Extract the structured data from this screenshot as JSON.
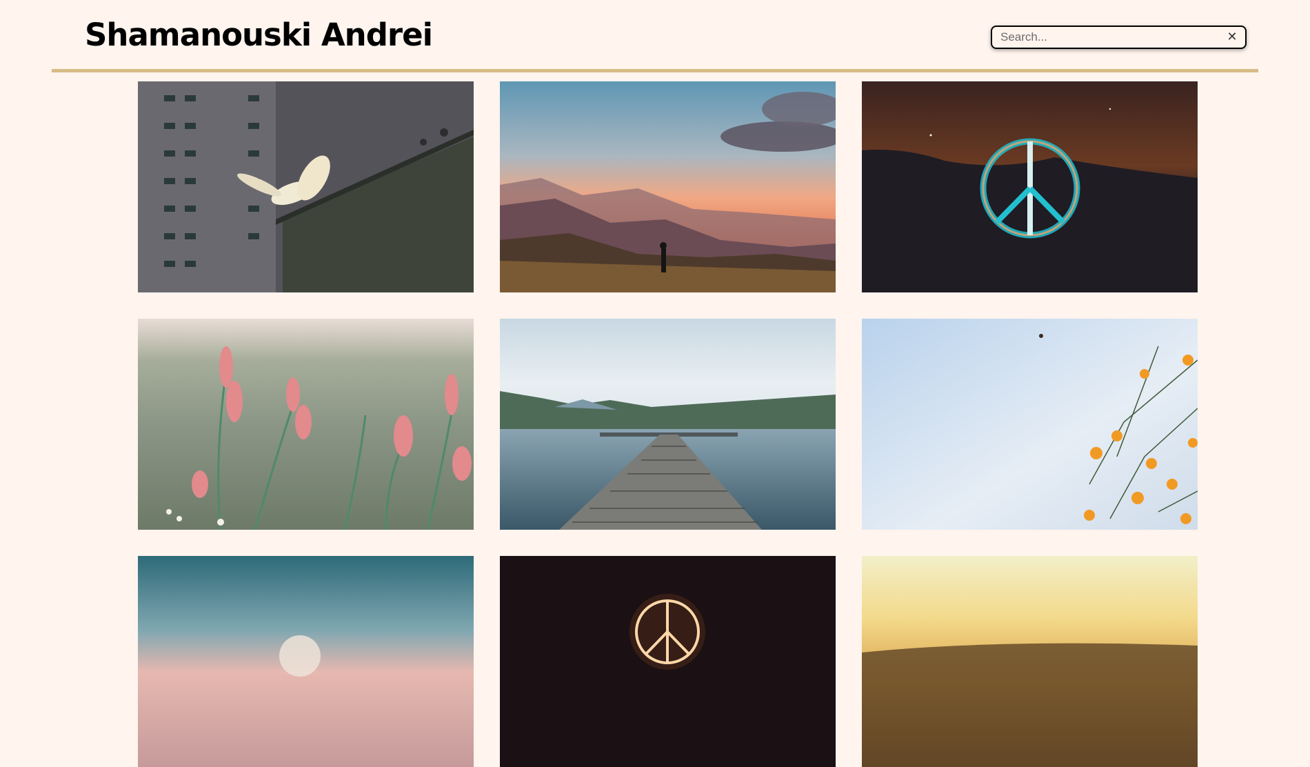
{
  "header": {
    "title": "Shamanouski Andrei"
  },
  "search": {
    "placeholder": "Search...",
    "value": "",
    "clear_icon": "close-icon"
  },
  "gallery": {
    "images": [
      {
        "subject": "dove-flying-by-building"
      },
      {
        "subject": "hiker-mountain-sunset"
      },
      {
        "subject": "neon-peace-sign-night"
      },
      {
        "subject": "pink-wild-grass"
      },
      {
        "subject": "wooden-pier-lake"
      },
      {
        "subject": "orange-flowers-sky"
      },
      {
        "subject": "dandelion-blurred-sky"
      },
      {
        "subject": "glowing-peace-sign-dark"
      },
      {
        "subject": "golden-sunset-horizon"
      }
    ]
  },
  "colors": {
    "background": "#fff4ee",
    "header_rule": "#d8bb86"
  }
}
